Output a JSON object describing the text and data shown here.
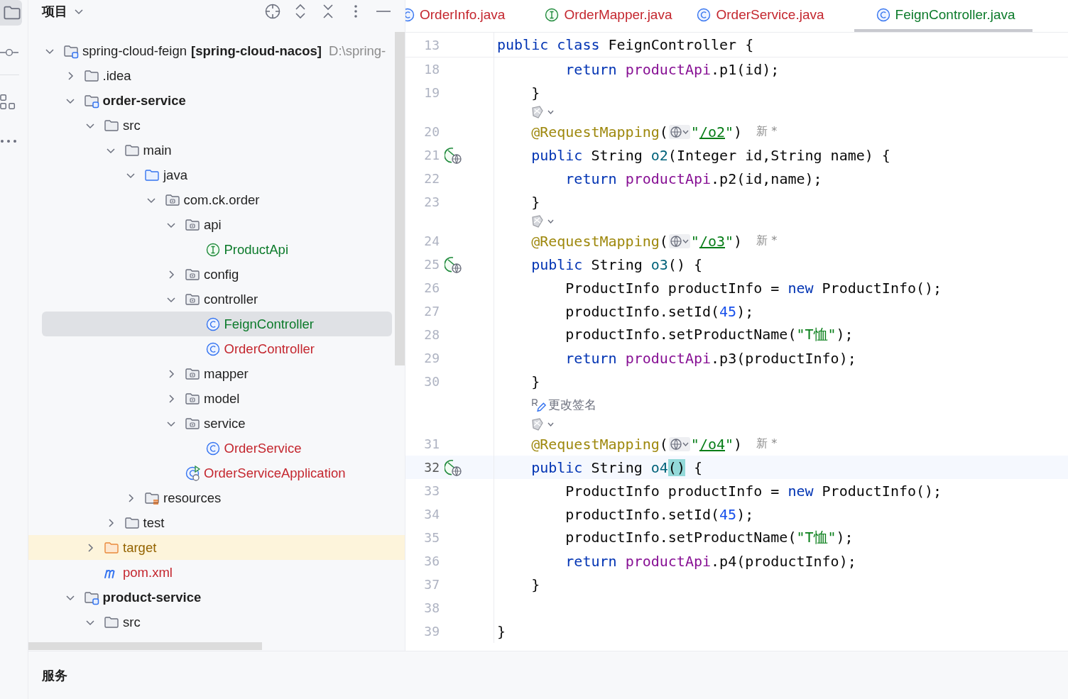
{
  "sidebar": {
    "panel_title": "项目",
    "tree": [
      {
        "label": "spring-cloud-feign",
        "qualifier": "[spring-cloud-nacos]",
        "path": "D:\\spring-",
        "kind": "project",
        "expanded": true,
        "selected": false,
        "children": [
          {
            "label": ".idea",
            "kind": "folder",
            "expanded": false,
            "selected": false
          },
          {
            "label": "order-service",
            "kind": "module",
            "expanded": true,
            "selected": false,
            "children": [
              {
                "label": "src",
                "kind": "folder",
                "expanded": true,
                "selected": false,
                "children": [
                  {
                    "label": "main",
                    "kind": "folder",
                    "expanded": true,
                    "selected": false,
                    "children": [
                      {
                        "label": "java",
                        "kind": "source",
                        "expanded": true,
                        "selected": false,
                        "children": [
                          {
                            "label": "com.ck.order",
                            "kind": "package",
                            "expanded": true,
                            "selected": false,
                            "children": [
                              {
                                "label": "api",
                                "kind": "package",
                                "expanded": true,
                                "selected": false,
                                "children": [
                                  {
                                    "label": "ProductApi",
                                    "kind": "interface",
                                    "color": "#0b7a2a",
                                    "selected": false
                                  }
                                ]
                              },
                              {
                                "label": "config",
                                "kind": "package",
                                "expanded": false,
                                "selected": false
                              },
                              {
                                "label": "controller",
                                "kind": "package",
                                "expanded": true,
                                "selected": false,
                                "children": [
                                  {
                                    "label": "FeignController",
                                    "kind": "class",
                                    "color": "#0b7a2a",
                                    "selected": true
                                  },
                                  {
                                    "label": "OrderController",
                                    "kind": "class",
                                    "color": "#c4262e",
                                    "selected": false
                                  }
                                ]
                              },
                              {
                                "label": "mapper",
                                "kind": "package",
                                "expanded": false,
                                "selected": false
                              },
                              {
                                "label": "model",
                                "kind": "package",
                                "expanded": false,
                                "selected": false
                              },
                              {
                                "label": "service",
                                "kind": "package",
                                "expanded": true,
                                "selected": false,
                                "children": [
                                  {
                                    "label": "OrderService",
                                    "kind": "class",
                                    "color": "#c4262e",
                                    "selected": false
                                  }
                                ]
                              },
                              {
                                "label": "OrderServiceApplication",
                                "kind": "app",
                                "color": "#c4262e",
                                "selected": false
                              }
                            ]
                          }
                        ]
                      },
                      {
                        "label": "resources",
                        "kind": "resources",
                        "expanded": false,
                        "selected": false
                      }
                    ]
                  },
                  {
                    "label": "test",
                    "kind": "folder",
                    "expanded": false,
                    "selected": false
                  }
                ]
              },
              {
                "label": "target",
                "kind": "excluded",
                "color": "#946300",
                "expanded": false,
                "selected": false
              },
              {
                "label": "pom.xml",
                "kind": "maven",
                "color": "#c4262e",
                "selected": false
              }
            ]
          },
          {
            "label": "product-service",
            "kind": "module",
            "expanded": true,
            "selected": false,
            "children": [
              {
                "label": "src",
                "kind": "folder",
                "expanded": true,
                "selected": false
              }
            ]
          }
        ]
      }
    ]
  },
  "tabs": [
    {
      "label": "OrderInfo.java",
      "kind": "class",
      "color": "#c4262e",
      "selected": false
    },
    {
      "label": "OrderMapper.java",
      "kind": "interface",
      "color": "#c4262e",
      "selected": false
    },
    {
      "label": "OrderService.java",
      "kind": "class",
      "color": "#c4262e",
      "selected": false
    },
    {
      "label": "FeignController.java",
      "kind": "class",
      "color": "#0b7a2a",
      "selected": true
    }
  ],
  "editor": {
    "lines": [
      {
        "kind": "code",
        "number": "13",
        "sticky": true,
        "endpoint": false,
        "current": false,
        "tokens": [
          {
            "kind": "kw",
            "text": "public class"
          },
          {
            "kind": "plain",
            "text": " FeignController {"
          }
        ]
      },
      {
        "kind": "code",
        "number": "18",
        "sticky": false,
        "endpoint": false,
        "current": false,
        "tokens": [
          {
            "kind": "kw",
            "text": "        return "
          },
          {
            "kind": "field",
            "text": "productApi"
          },
          {
            "kind": "plain",
            "text": ".p1(id);"
          }
        ]
      },
      {
        "kind": "code",
        "number": "19",
        "sticky": false,
        "endpoint": false,
        "current": false,
        "tokens": [
          {
            "kind": "plain",
            "text": "    }"
          }
        ]
      },
      {
        "kind": "inlay"
      },
      {
        "kind": "code",
        "number": "20",
        "sticky": false,
        "endpoint": false,
        "current": false,
        "hint": "新 *",
        "tokens": [
          {
            "kind": "ann",
            "text": "    @RequestMapping"
          },
          {
            "kind": "plain",
            "text": "("
          },
          {
            "kind": "globe"
          },
          {
            "kind": "str",
            "text": "\""
          },
          {
            "kind": "url",
            "text": "/o2"
          },
          {
            "kind": "str",
            "text": "\""
          },
          {
            "kind": "plain",
            "text": ")"
          }
        ]
      },
      {
        "kind": "code",
        "number": "21",
        "sticky": false,
        "endpoint": true,
        "current": false,
        "tokens": [
          {
            "kind": "kw",
            "text": "    public"
          },
          {
            "kind": "plain",
            "text": " String "
          },
          {
            "kind": "method",
            "text": "o2"
          },
          {
            "kind": "plain",
            "text": "(Integer id,String name) {"
          }
        ]
      },
      {
        "kind": "code",
        "number": "22",
        "sticky": false,
        "endpoint": false,
        "current": false,
        "tokens": [
          {
            "kind": "kw",
            "text": "        return "
          },
          {
            "kind": "field",
            "text": "productApi"
          },
          {
            "kind": "plain",
            "text": ".p2(id,name);"
          }
        ]
      },
      {
        "kind": "code",
        "number": "23",
        "sticky": false,
        "endpoint": false,
        "current": false,
        "tokens": [
          {
            "kind": "plain",
            "text": "    }"
          }
        ]
      },
      {
        "kind": "inlay"
      },
      {
        "kind": "code",
        "number": "24",
        "sticky": false,
        "endpoint": false,
        "current": false,
        "hint": "新 *",
        "tokens": [
          {
            "kind": "ann",
            "text": "    @RequestMapping"
          },
          {
            "kind": "plain",
            "text": "("
          },
          {
            "kind": "globe"
          },
          {
            "kind": "str",
            "text": "\""
          },
          {
            "kind": "url",
            "text": "/o3"
          },
          {
            "kind": "str",
            "text": "\""
          },
          {
            "kind": "plain",
            "text": ")"
          }
        ]
      },
      {
        "kind": "code",
        "number": "25",
        "sticky": false,
        "endpoint": true,
        "current": false,
        "tokens": [
          {
            "kind": "kw",
            "text": "    public"
          },
          {
            "kind": "plain",
            "text": " String "
          },
          {
            "kind": "method",
            "text": "o3"
          },
          {
            "kind": "plain",
            "text": "() {"
          }
        ]
      },
      {
        "kind": "code",
        "number": "26",
        "sticky": false,
        "endpoint": false,
        "current": false,
        "tokens": [
          {
            "kind": "plain",
            "text": "        ProductInfo productInfo = "
          },
          {
            "kind": "kw",
            "text": "new"
          },
          {
            "kind": "plain",
            "text": " ProductInfo();"
          }
        ]
      },
      {
        "kind": "code",
        "number": "27",
        "sticky": false,
        "endpoint": false,
        "current": false,
        "tokens": [
          {
            "kind": "plain",
            "text": "        productInfo.setId("
          },
          {
            "kind": "num",
            "text": "45"
          },
          {
            "kind": "plain",
            "text": ");"
          }
        ]
      },
      {
        "kind": "code",
        "number": "28",
        "sticky": false,
        "endpoint": false,
        "current": false,
        "tokens": [
          {
            "kind": "plain",
            "text": "        productInfo.setProductName("
          },
          {
            "kind": "str",
            "text": "\"T恤\""
          },
          {
            "kind": "plain",
            "text": ");"
          }
        ]
      },
      {
        "kind": "code",
        "number": "29",
        "sticky": false,
        "endpoint": false,
        "current": false,
        "tokens": [
          {
            "kind": "kw",
            "text": "        return "
          },
          {
            "kind": "field",
            "text": "productApi"
          },
          {
            "kind": "plain",
            "text": ".p3(productInfo);"
          }
        ]
      },
      {
        "kind": "code",
        "number": "30",
        "sticky": false,
        "endpoint": false,
        "current": false,
        "tokens": [
          {
            "kind": "plain",
            "text": "    }"
          }
        ]
      },
      {
        "kind": "rename",
        "text": "更改签名"
      },
      {
        "kind": "inlay"
      },
      {
        "kind": "code",
        "number": "31",
        "sticky": false,
        "endpoint": false,
        "current": false,
        "hint": "新 *",
        "tokens": [
          {
            "kind": "ann",
            "text": "    @RequestMapping"
          },
          {
            "kind": "plain",
            "text": "("
          },
          {
            "kind": "globe"
          },
          {
            "kind": "str",
            "text": "\""
          },
          {
            "kind": "url",
            "text": "/o4"
          },
          {
            "kind": "str",
            "text": "\""
          },
          {
            "kind": "plain",
            "text": ")"
          }
        ]
      },
      {
        "kind": "code",
        "number": "32",
        "sticky": false,
        "endpoint": true,
        "current": true,
        "tokens": [
          {
            "kind": "kw",
            "text": "    public"
          },
          {
            "kind": "plain",
            "text": " String "
          },
          {
            "kind": "method",
            "text": "o4"
          },
          {
            "kind": "match",
            "text": "()"
          },
          {
            "kind": "plain",
            "text": " {"
          }
        ]
      },
      {
        "kind": "code",
        "number": "33",
        "sticky": false,
        "endpoint": false,
        "current": false,
        "tokens": [
          {
            "kind": "plain",
            "text": "        ProductInfo productInfo = "
          },
          {
            "kind": "kw",
            "text": "new"
          },
          {
            "kind": "plain",
            "text": " ProductInfo();"
          }
        ]
      },
      {
        "kind": "code",
        "number": "34",
        "sticky": false,
        "endpoint": false,
        "current": false,
        "tokens": [
          {
            "kind": "plain",
            "text": "        productInfo.setId("
          },
          {
            "kind": "num",
            "text": "45"
          },
          {
            "kind": "plain",
            "text": ");"
          }
        ]
      },
      {
        "kind": "code",
        "number": "35",
        "sticky": false,
        "endpoint": false,
        "current": false,
        "tokens": [
          {
            "kind": "plain",
            "text": "        productInfo.setProductName("
          },
          {
            "kind": "str",
            "text": "\"T恤\""
          },
          {
            "kind": "plain",
            "text": ");"
          }
        ]
      },
      {
        "kind": "code",
        "number": "36",
        "sticky": false,
        "endpoint": false,
        "current": false,
        "tokens": [
          {
            "kind": "kw",
            "text": "        return "
          },
          {
            "kind": "field",
            "text": "productApi"
          },
          {
            "kind": "plain",
            "text": ".p4(productInfo);"
          }
        ]
      },
      {
        "kind": "code",
        "number": "37",
        "sticky": false,
        "endpoint": false,
        "current": false,
        "tokens": [
          {
            "kind": "plain",
            "text": "    }"
          }
        ]
      },
      {
        "kind": "code",
        "number": "38",
        "sticky": false,
        "endpoint": false,
        "current": false
      },
      {
        "kind": "code",
        "number": "39",
        "sticky": false,
        "endpoint": false,
        "current": false,
        "tokens": [
          {
            "kind": "plain",
            "text": "}"
          }
        ]
      }
    ]
  },
  "bottom_panel": {
    "title": "服务"
  }
}
